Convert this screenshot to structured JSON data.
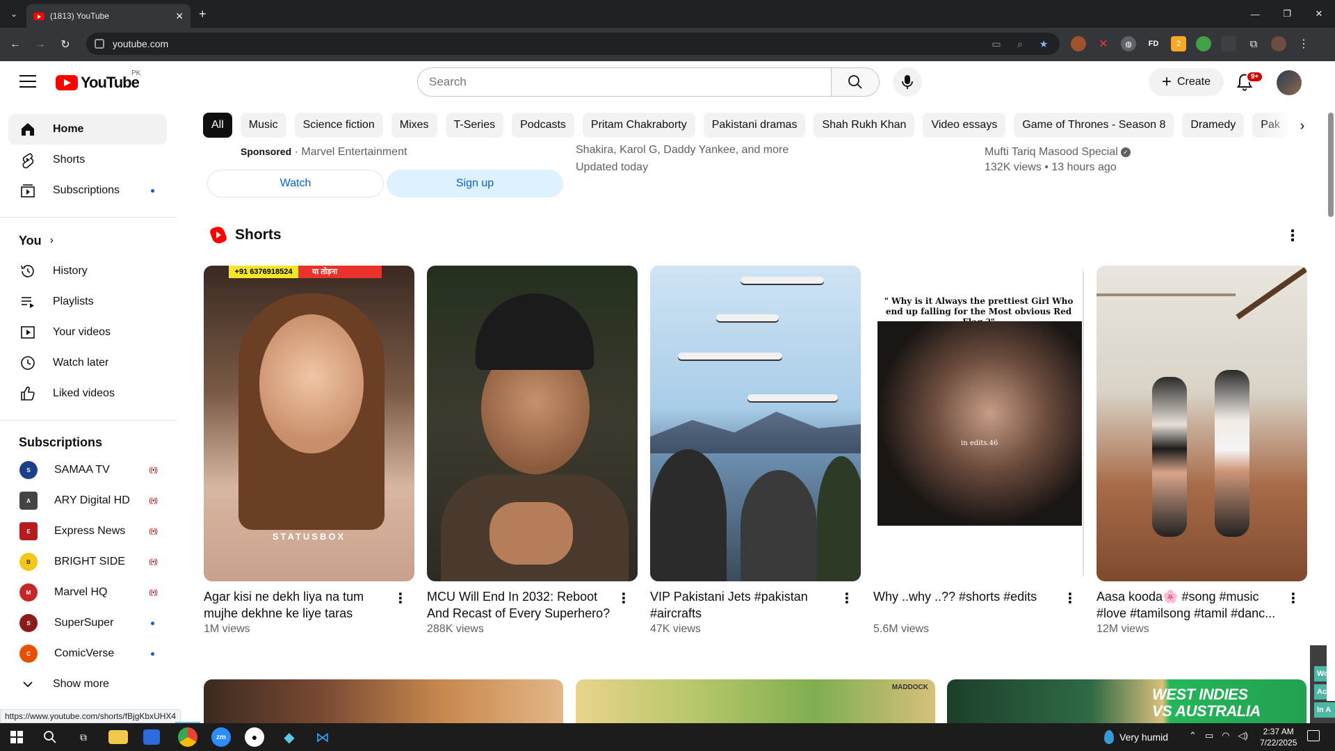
{
  "browser": {
    "tab_title": "(1813) YouTube",
    "url": "youtube.com",
    "new_tab": "+",
    "tab_close": "✕",
    "ext_fd": "FD",
    "ext_badge": "2"
  },
  "header": {
    "logo_word": "YouTube",
    "country_code": "PK",
    "search_placeholder": "Search",
    "create_label": "Create",
    "notification_count": "9+"
  },
  "sidebar": {
    "main": [
      {
        "label": "Home",
        "icon": "home-icon",
        "active": true
      },
      {
        "label": "Shorts",
        "icon": "shorts-icon"
      },
      {
        "label": "Subscriptions",
        "icon": "subscriptions-icon",
        "dot": true
      }
    ],
    "you_heading": "You",
    "you_items": [
      {
        "label": "History",
        "icon": "history-icon"
      },
      {
        "label": "Playlists",
        "icon": "playlists-icon"
      },
      {
        "label": "Your videos",
        "icon": "your-videos-icon"
      },
      {
        "label": "Watch later",
        "icon": "watch-later-icon"
      },
      {
        "label": "Liked videos",
        "icon": "liked-videos-icon"
      }
    ],
    "subs_heading": "Subscriptions",
    "subscriptions": [
      {
        "label": "SAMAA TV",
        "status": "live",
        "color": "#1d3f8a"
      },
      {
        "label": "ARY Digital HD",
        "status": "live",
        "color": "#444444"
      },
      {
        "label": "Express News",
        "status": "live",
        "color": "#b71c1c"
      },
      {
        "label": "BRIGHT SIDE",
        "status": "live",
        "color": "#f5c518"
      },
      {
        "label": "Marvel HQ",
        "status": "live",
        "color": "#c62828"
      },
      {
        "label": "SuperSuper",
        "status": "new",
        "color": "#8e1b1b"
      },
      {
        "label": "ComicVerse",
        "status": "new",
        "color": "#e65100"
      }
    ],
    "show_more": "Show more",
    "live_glyph": "((•))"
  },
  "chips": [
    "All",
    "Music",
    "Science fiction",
    "Mixes",
    "T-Series",
    "Podcasts",
    "Pritam Chakraborty",
    "Pakistani dramas",
    "Shah Rukh Khan",
    "Video essays",
    "Game of Thrones - Season 8",
    "Dramedy",
    "Pak"
  ],
  "top_row": {
    "sponsored_label": "Sponsored",
    "sponsor": "Marvel Entertainment",
    "watch_label": "Watch",
    "signup_label": "Sign up",
    "mix_line1": "Shakira, Karol G, Daddy Yankee, and more",
    "mix_line2": "Updated today",
    "vid_channel": "Mufti Tariq Masood Special",
    "vid_meta": "132K views • 13 hours ago"
  },
  "shorts": {
    "heading": "Shorts",
    "items": [
      {
        "title": "Agar kisi ne dekh liya na tum mujhe dekhne ke liye taras jaog...",
        "views": "1M views"
      },
      {
        "title": "MCU Will End In 2032: Reboot And Recast of Every Superhero?",
        "views": "288K views"
      },
      {
        "title": "VIP Pakistani Jets #pakistan #aircrafts",
        "views": "47K views"
      },
      {
        "title": "Why ..why ..?? #shorts #edits",
        "views": "5.6M views"
      },
      {
        "title": "Aasa kooda🌸 #song #music #love #tamilsong #tamil #danc...",
        "views": "12M views"
      }
    ],
    "thumb1_phone": "+91 6376918524",
    "thumb1_tag": "या तोड़ना",
    "thumb1_watermark": "STATUSBOX",
    "thumb4_caption": "\" Why is it Always the prettiest Girl Who end up falling for the Most obvious Red Flag ?\"",
    "thumb4_watermark": "in edits.46"
  },
  "bottom_row": {
    "thumb2_logo": "MADDOCK",
    "thumb3_text1": "WEST INDIES",
    "thumb3_text2": "VS AUSTRALIA"
  },
  "right_edge": [
    "Wor",
    "Acti",
    "In A"
  ],
  "status_url": "https://www.youtube.com/shorts/fBjgKbxUHX4",
  "taskbar": {
    "weather": "Very humid",
    "time": "2:37 AM",
    "date": "7/22/2025"
  }
}
